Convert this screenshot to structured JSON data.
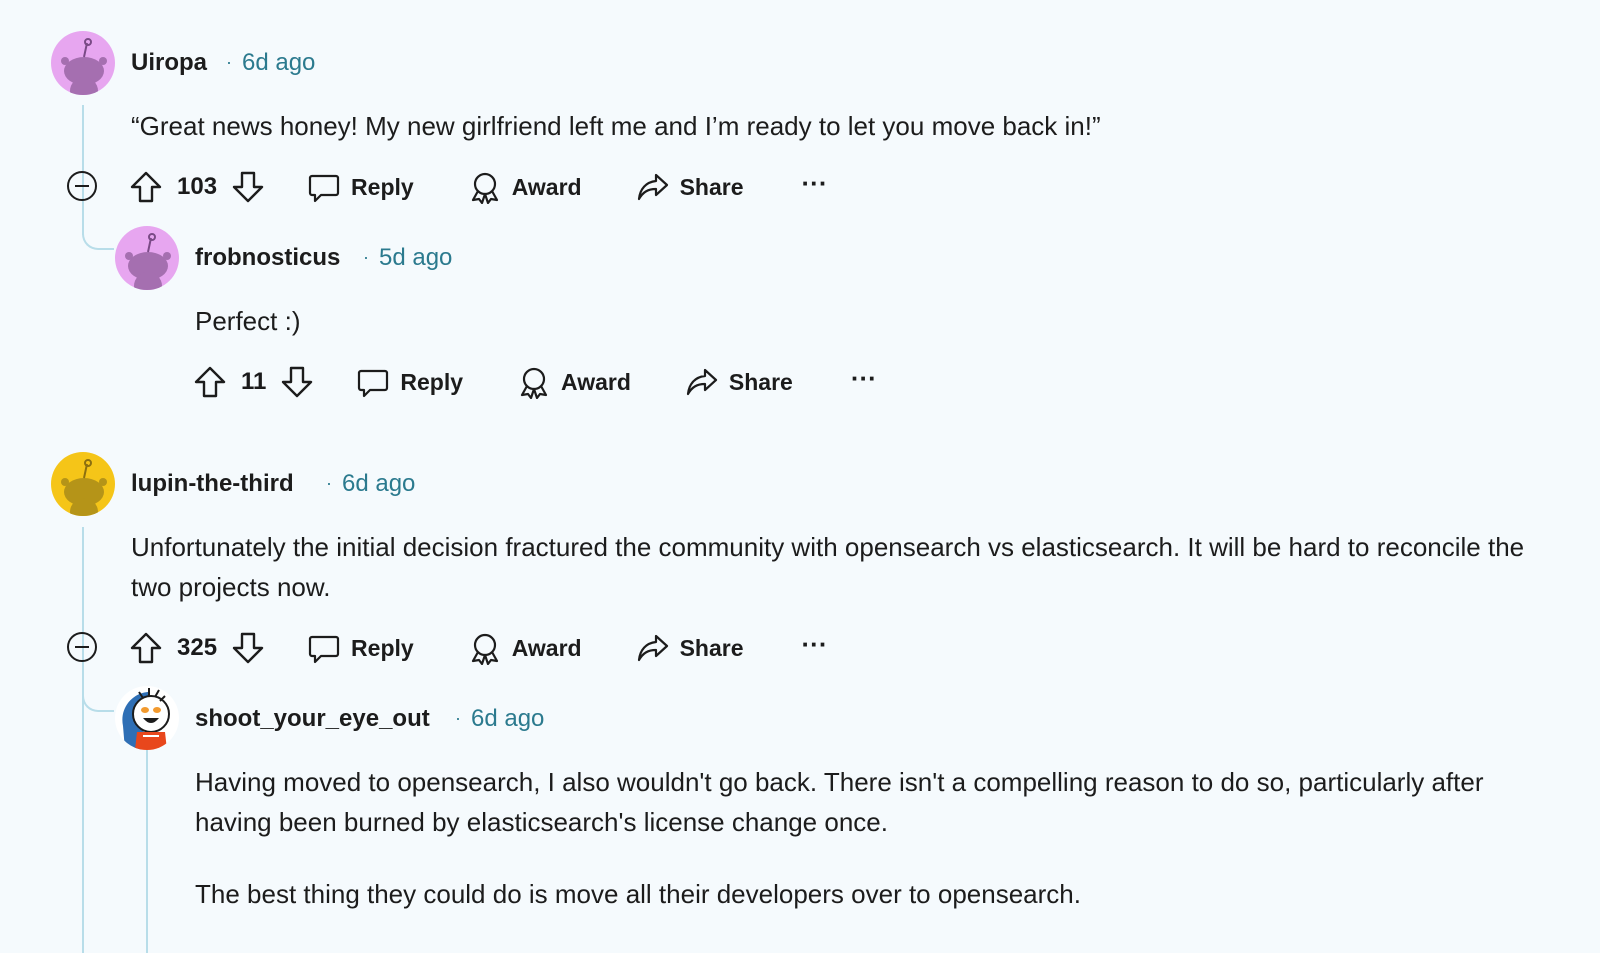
{
  "comments": [
    {
      "username": "Uiropa",
      "time": "6d ago",
      "body": [
        "“Great news honey! My new girlfriend left me and I’m ready to let you move back in!”"
      ],
      "votes": "103",
      "avatar_color": "#e7a6f0"
    },
    {
      "username": "frobnosticus",
      "time": "5d ago",
      "body": [
        "Perfect :)"
      ],
      "votes": "11",
      "avatar_color": "#e7a6f0"
    },
    {
      "username": "lupin-the-third",
      "time": "6d ago",
      "body": [
        "Unfortunately the initial decision fractured the community with opensearch vs elasticsearch. It will be hard to reconcile the two projects now."
      ],
      "votes": "325",
      "avatar_color": "#f5c518"
    },
    {
      "username": "shoot_your_eye_out",
      "time": "6d ago",
      "body": [
        "Having moved to opensearch, I also wouldn't go back. There isn't a compelling reason to do so, particularly after having been burned by elasticsearch's license change once.",
        "The best thing they could do is move all their developers over to opensearch."
      ],
      "avatar_color": "#ffffff"
    }
  ],
  "actions": {
    "reply": "Reply",
    "award": "Award",
    "share": "Share",
    "more": "···"
  },
  "separator": "·",
  "colors": {
    "background": "#f5fafd",
    "thread_line": "#b8dde9",
    "timestamp": "#2b7a8e",
    "text": "#1c1c1c"
  }
}
